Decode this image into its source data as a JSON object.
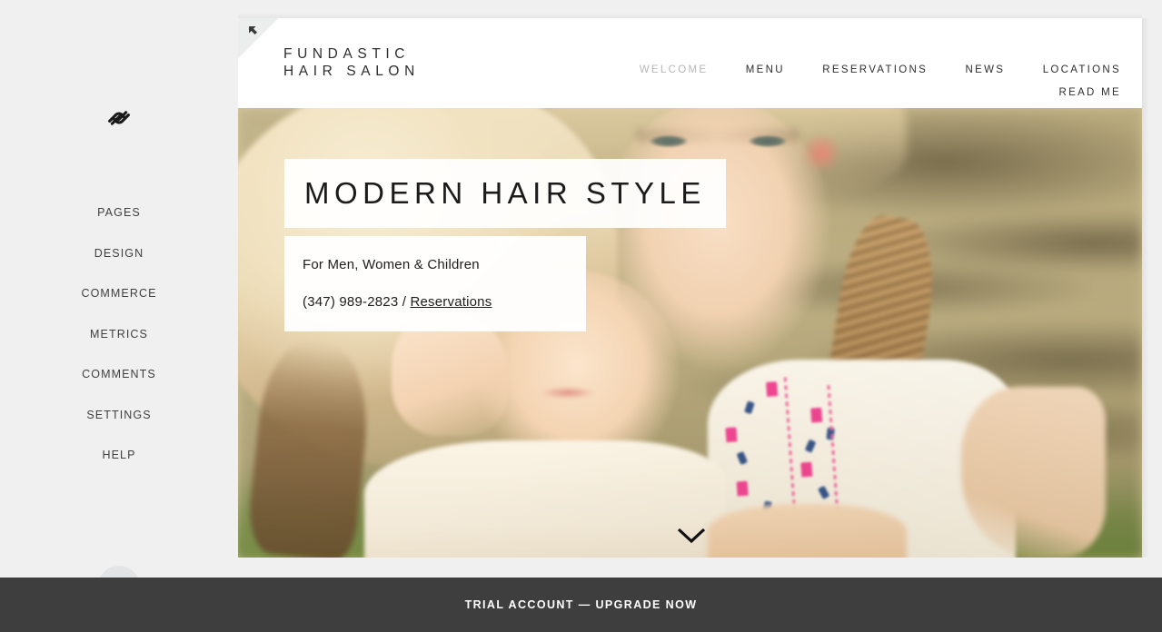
{
  "admin": {
    "logo_icon": "squarespace-logo-icon",
    "nav_items": [
      {
        "label": "PAGES"
      },
      {
        "label": "DESIGN"
      },
      {
        "label": "COMMERCE"
      },
      {
        "label": "METRICS"
      },
      {
        "label": "COMMENTS"
      },
      {
        "label": "SETTINGS"
      },
      {
        "label": "HELP"
      }
    ],
    "avatar": "user-avatar-placeholder"
  },
  "preview": {
    "back_arrow_icon": "arrow-up-left-icon",
    "site": {
      "title": "FUNDASTIC\nHAIR SALON",
      "nav": [
        {
          "label": "WELCOME",
          "active": true
        },
        {
          "label": "MENU",
          "active": false
        },
        {
          "label": "RESERVATIONS",
          "active": false
        },
        {
          "label": "NEWS",
          "active": false
        },
        {
          "label": "LOCATIONS",
          "active": false
        },
        {
          "label": "READ ME",
          "active": false
        }
      ],
      "hero": {
        "headline": "MODERN HAIR STYLE",
        "subtitle": "For Men, Women & Children",
        "phone": "(347) 989-2823 / ",
        "reservations_link": "Reservations",
        "scroll_icon": "chevron-down-icon"
      }
    }
  },
  "trial_banner": {
    "text": "TRIAL ACCOUNT — UPGRADE NOW"
  },
  "colors": {
    "app_background": "#f0f0f0",
    "banner_background": "#3e3e3e",
    "banner_text": "#ffffff",
    "sidebar_text": "#3f3f3f",
    "site_text": "#2e2e2e",
    "nav_active": "#b6b6b6"
  }
}
